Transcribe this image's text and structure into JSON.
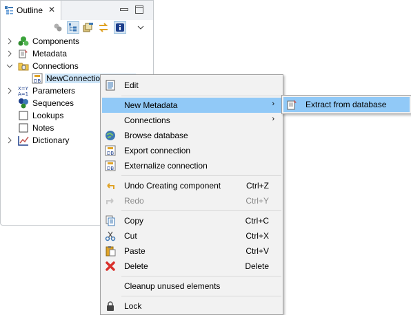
{
  "outline": {
    "tab_title": "Outline",
    "tab_icon": "outline-icon",
    "tree": [
      {
        "label": "Components",
        "icon": "components-icon",
        "twisty": "collapsed"
      },
      {
        "label": "Metadata",
        "icon": "metadata-icon",
        "twisty": "collapsed"
      },
      {
        "label": "Connections",
        "icon": "connections-folder-icon",
        "twisty": "expanded"
      },
      {
        "label": "NewConnection (H2DB)",
        "icon": "db-connection-icon",
        "twisty": "none",
        "selected": true
      },
      {
        "label": "Parameters",
        "icon": "parameters-icon",
        "twisty": "collapsed"
      },
      {
        "label": "Sequences",
        "icon": "sequences-icon",
        "twisty": "none"
      },
      {
        "label": "Lookups",
        "icon": "lookups-icon",
        "twisty": "none"
      },
      {
        "label": "Notes",
        "icon": "notes-icon",
        "twisty": "none"
      },
      {
        "label": "Dictionary",
        "icon": "dictionary-icon",
        "twisty": "collapsed"
      }
    ]
  },
  "context_menu": {
    "items": [
      {
        "label": "Edit",
        "shortcut": "",
        "icon": "edit-icon"
      },
      {
        "label": "New Metadata",
        "shortcut": "",
        "submenu": true,
        "highlighted": true
      },
      {
        "label": "Connections",
        "shortcut": "",
        "submenu": true
      },
      {
        "label": "Browse database",
        "shortcut": "",
        "icon": "browse-database-icon"
      },
      {
        "label": "Export connection",
        "shortcut": "",
        "icon": "export-db-icon"
      },
      {
        "label": "Externalize connection",
        "shortcut": "",
        "icon": "externalize-db-icon"
      },
      {
        "label": "Undo Creating component",
        "shortcut": "Ctrl+Z",
        "icon": "undo-icon"
      },
      {
        "label": "Redo",
        "shortcut": "Ctrl+Y",
        "icon": "redo-icon",
        "disabled": true
      },
      {
        "label": "Copy",
        "shortcut": "Ctrl+C",
        "icon": "copy-icon"
      },
      {
        "label": "Cut",
        "shortcut": "Ctrl+X",
        "icon": "cut-icon"
      },
      {
        "label": "Paste",
        "shortcut": "Ctrl+V",
        "icon": "paste-icon"
      },
      {
        "label": "Delete",
        "shortcut": "Delete",
        "icon": "delete-icon"
      },
      {
        "label": "Cleanup unused elements",
        "shortcut": ""
      },
      {
        "label": "Lock",
        "shortcut": "",
        "icon": "lock-icon"
      }
    ]
  },
  "submenu": {
    "items": [
      {
        "label": "Extract from database",
        "icon": "extract-icon",
        "highlighted": true
      }
    ]
  },
  "colors": {
    "highlight": "#91c9f7",
    "selection": "#cce4f7",
    "menu_bg": "#f2f2f2"
  }
}
